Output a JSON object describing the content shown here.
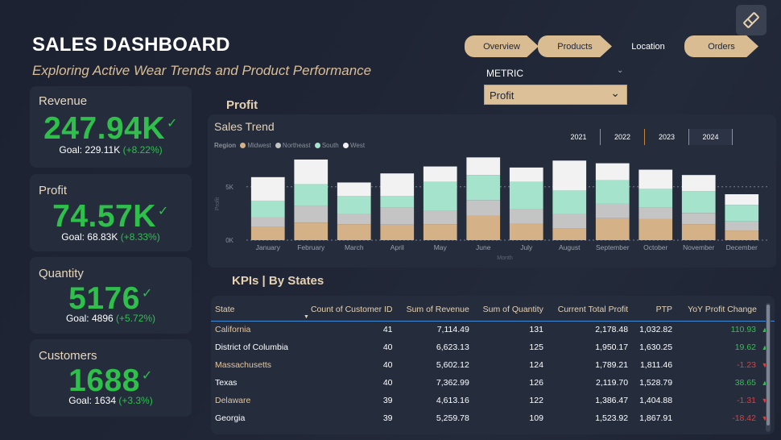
{
  "header": {
    "title": "SALES DASHBOARD",
    "subtitle": "Exploring Active Wear Trends and Product Performance"
  },
  "nav": {
    "buttons": [
      {
        "label": "Overview",
        "active": false
      },
      {
        "label": "Products",
        "active": false
      },
      {
        "label": "Location",
        "active": true
      },
      {
        "label": "Orders",
        "active": false
      }
    ]
  },
  "metric": {
    "label": "METRIC",
    "selected": "Profit"
  },
  "kpi_cards": [
    {
      "name": "Revenue",
      "value": "247.94K",
      "goal": "Goal: 229.11K",
      "pct": "(+8.22%)"
    },
    {
      "name": "Profit",
      "value": "74.57K",
      "goal": "Goal: 68.83K",
      "pct": "(+8.33%)"
    },
    {
      "name": "Quantity",
      "value": "5176",
      "goal": "Goal: 4896",
      "pct": "(+5.72%)"
    },
    {
      "name": "Customers",
      "value": "1688",
      "goal": "Goal: 1634",
      "pct": "(+3.3%)"
    }
  ],
  "check_glyph": "✓",
  "chart_section": {
    "heading": "Profit",
    "title": "Sales Trend",
    "years": [
      "2021",
      "2022",
      "2023",
      "2024"
    ],
    "selected_year": "2024",
    "legend_title": "Region",
    "colors": {
      "Midwest": "#d5b187",
      "Northeast": "#c4c4c4",
      "South": "#a6e3cc",
      "West": "#f2f2f2"
    }
  },
  "chart_data": {
    "type": "bar",
    "stacked": true,
    "title": "Sales Trend",
    "xlabel": "Month",
    "ylabel": "Profit",
    "categories": [
      "January",
      "February",
      "March",
      "April",
      "May",
      "June",
      "July",
      "August",
      "September",
      "October",
      "November",
      "December"
    ],
    "series": [
      {
        "name": "Midwest",
        "values": [
          1250,
          1650,
          1500,
          1450,
          1500,
          2300,
          1550,
          1100,
          2050,
          2000,
          1500,
          900
        ]
      },
      {
        "name": "Northeast",
        "values": [
          900,
          1550,
          950,
          1600,
          1250,
          1450,
          1350,
          1350,
          1350,
          1050,
          1050,
          850
        ]
      },
      {
        "name": "South",
        "values": [
          1550,
          2050,
          1700,
          1100,
          2700,
          2350,
          2550,
          2200,
          2200,
          1750,
          2050,
          1550
        ]
      },
      {
        "name": "West",
        "values": [
          2200,
          2300,
          1250,
          2100,
          1450,
          1650,
          1350,
          2800,
          1600,
          1800,
          1500,
          1000
        ]
      }
    ],
    "yticks": [
      "0K",
      "5K"
    ],
    "ylim": [
      0,
      8000
    ],
    "legend": "top-left"
  },
  "table_section": {
    "heading": "KPIs | By States",
    "columns": [
      "State",
      "Count of Customer ID",
      "Sum of Revenue",
      "Sum of Quantity",
      "Current Total Profit",
      "PTP",
      "YoY Profit Change"
    ],
    "sort_indicator": "▼",
    "rows": [
      {
        "state": "California",
        "count": "41",
        "revenue": "7,114.49",
        "quantity": "131",
        "profit": "2,178.48",
        "ptp": "1,032.82",
        "yoy": "110.93",
        "dir": "up"
      },
      {
        "state": "District of Columbia",
        "count": "40",
        "revenue": "6,623.13",
        "quantity": "125",
        "profit": "1,950.17",
        "ptp": "1,630.25",
        "yoy": "19.62",
        "dir": "up"
      },
      {
        "state": "Massachusetts",
        "count": "40",
        "revenue": "5,602.12",
        "quantity": "124",
        "profit": "1,789.21",
        "ptp": "1,811.46",
        "yoy": "-1.23",
        "dir": "down"
      },
      {
        "state": "Texas",
        "count": "40",
        "revenue": "7,362.99",
        "quantity": "126",
        "profit": "2,119.70",
        "ptp": "1,528.79",
        "yoy": "38.65",
        "dir": "up"
      },
      {
        "state": "Delaware",
        "count": "39",
        "revenue": "4,613.16",
        "quantity": "122",
        "profit": "1,386.47",
        "ptp": "1,404.88",
        "yoy": "-1.31",
        "dir": "down"
      },
      {
        "state": "Georgia",
        "count": "39",
        "revenue": "5,259.78",
        "quantity": "109",
        "profit": "1,523.92",
        "ptp": "1,867.91",
        "yoy": "-18.42",
        "dir": "down"
      }
    ]
  }
}
